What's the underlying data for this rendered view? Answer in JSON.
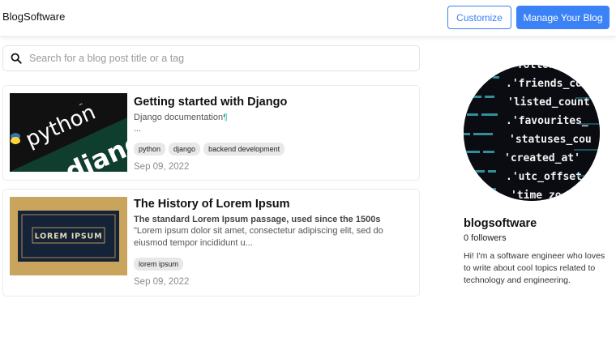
{
  "header": {
    "brand": "BlogSoftware",
    "customize_label": "Customize",
    "manage_label": "Manage Your Blog"
  },
  "search": {
    "placeholder": "Search for a blog post title or a tag",
    "value": ""
  },
  "posts": [
    {
      "title": "Getting started with Django",
      "subtitle": "Django documentation",
      "subtitle_mark": "¶",
      "excerpt": "...",
      "tags": [
        "python",
        "django",
        "backend development"
      ],
      "date": "Sep 09, 2022",
      "thumbnail": {
        "python_text": "python",
        "django_text": "django",
        "tm": "™"
      }
    },
    {
      "title": "The History of Lorem Ipsum",
      "subtitle": "The standard Lorem Ipsum passage, used since the 1500s",
      "excerpt": "\"Lorem ipsum dolor sit amet, consectetur adipiscing elit, sed do eiusmod tempor incididunt u...",
      "tags": [
        "lorem ipsum"
      ],
      "date": "Sep 09, 2022",
      "thumbnail": {
        "banner_text": "LOREM IPSUM"
      }
    }
  ],
  "profile": {
    "name": "blogsoftware",
    "followers": "0 followers",
    "bio": "Hi! I'm a software engineer who loves to write about cool topics related to technology and engineering.",
    "avatar_code_lines": [
      "'followers_",
      ".'friends_cou",
      "'listed_count",
      ".'favourites_",
      "'statuses_cou",
      "'created_at'",
      ".'utc_offset",
      "'time_zo"
    ]
  },
  "colors": {
    "accent": "#3b82f6",
    "django_green": "#103e2e",
    "lorem_gold": "#c9a45c",
    "lorem_navy": "#152338"
  }
}
